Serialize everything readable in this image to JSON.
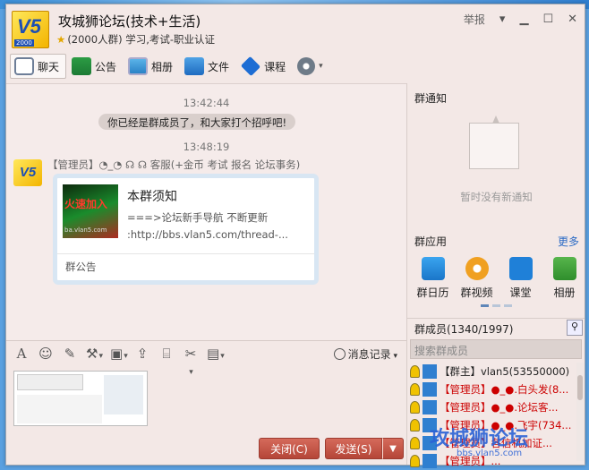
{
  "window": {
    "title": "攻城狮论坛(技术+生活)",
    "subtitle": "(2000人群) 学习,考试-职业认证",
    "report_label": "举报",
    "logo_text": "V5",
    "logo_year": "2000"
  },
  "tabs": [
    {
      "label": "聊天",
      "icon": "chat-icon"
    },
    {
      "label": "公告",
      "icon": "flag-icon"
    },
    {
      "label": "相册",
      "icon": "album-icon"
    },
    {
      "label": "文件",
      "icon": "file-icon"
    },
    {
      "label": "课程",
      "icon": "course-icon"
    }
  ],
  "chat": {
    "time1": "13:42:44",
    "system_message": "你已经是群成员了，和大家打个招呼吧!",
    "time2": "13:48:19",
    "sender": "【管理员】◔_◔ ☊ ☊ 客服(+金币 考试 报名 论坛事务)",
    "card": {
      "thumb_text": "火速加入",
      "thumb_url": "ba.vlan5.com",
      "title": "本群须知",
      "line1": "===>论坛新手导航 不断更新",
      "line2": ":http://bbs.vlan5.com/thread-...",
      "footer": "群公告"
    }
  },
  "toolbar": {
    "history_label": "消息记录"
  },
  "buttons": {
    "close_label": "关闭(C)",
    "send_label": "发送(S)"
  },
  "right_panel": {
    "notice_title": "群通知",
    "notice_empty": "暂时没有新通知",
    "apps_title": "群应用",
    "more_label": "更多",
    "apps": [
      {
        "label": "群日历",
        "icon": "calendar-icon"
      },
      {
        "label": "群视频",
        "icon": "video-icon"
      },
      {
        "label": "课堂",
        "icon": "classroom-icon"
      },
      {
        "label": "相册",
        "icon": "album-icon"
      }
    ],
    "members_title": "群成员(1340/1997)",
    "search_placeholder": "搜索群成员",
    "members": [
      {
        "text": "【群主】vlan5(53550000)",
        "role": "owner"
      },
      {
        "text": "【管理员】●_●.白头发(8...",
        "role": "admin"
      },
      {
        "text": "【管理员】●_●.论坛客...",
        "role": "admin"
      },
      {
        "text": "【管理员】●_●.飞宇(734...",
        "role": "admin"
      },
      {
        "text": "【管理员】各信机加证...",
        "role": "admin"
      },
      {
        "text": "【管理员】...",
        "role": "admin"
      }
    ]
  },
  "watermark": {
    "text": "攻城狮论坛",
    "url": "bbs.vlan5.com"
  }
}
